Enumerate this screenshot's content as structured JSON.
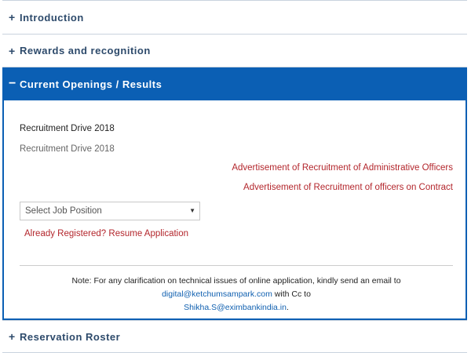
{
  "accordion": {
    "introduction": {
      "symbol": "+",
      "label": "Introduction"
    },
    "rewards": {
      "symbol": "+",
      "label": "Rewards and recognition"
    },
    "current": {
      "symbol": "−",
      "label": "Current Openings / Results"
    },
    "roster": {
      "symbol": "+",
      "label": "Reservation Roster"
    }
  },
  "panel": {
    "drive_title": "Recruitment Drive 2018",
    "drive_subtitle": "Recruitment Drive 2018",
    "ad_links": [
      "Advertisement of Recruitment of Administrative Officers",
      "Advertisement of Recruitment of officers on Contract"
    ],
    "job_select": {
      "selected": "Select Job Position",
      "arrow": "▼"
    },
    "resume_link": "Already Registered? Resume Application",
    "note": {
      "prefix": "Note: For any clarification on technical issues of online application, kindly send an email to ",
      "email1": "digital@ketchumsampark.com",
      "middle": " with Cc to",
      "email2": "Shikha.S@eximbankindia.in",
      "suffix": "."
    }
  },
  "colors": {
    "accent_blue": "#0b5fb4",
    "link_red": "#b3262c",
    "link_blue": "#1060b0"
  }
}
